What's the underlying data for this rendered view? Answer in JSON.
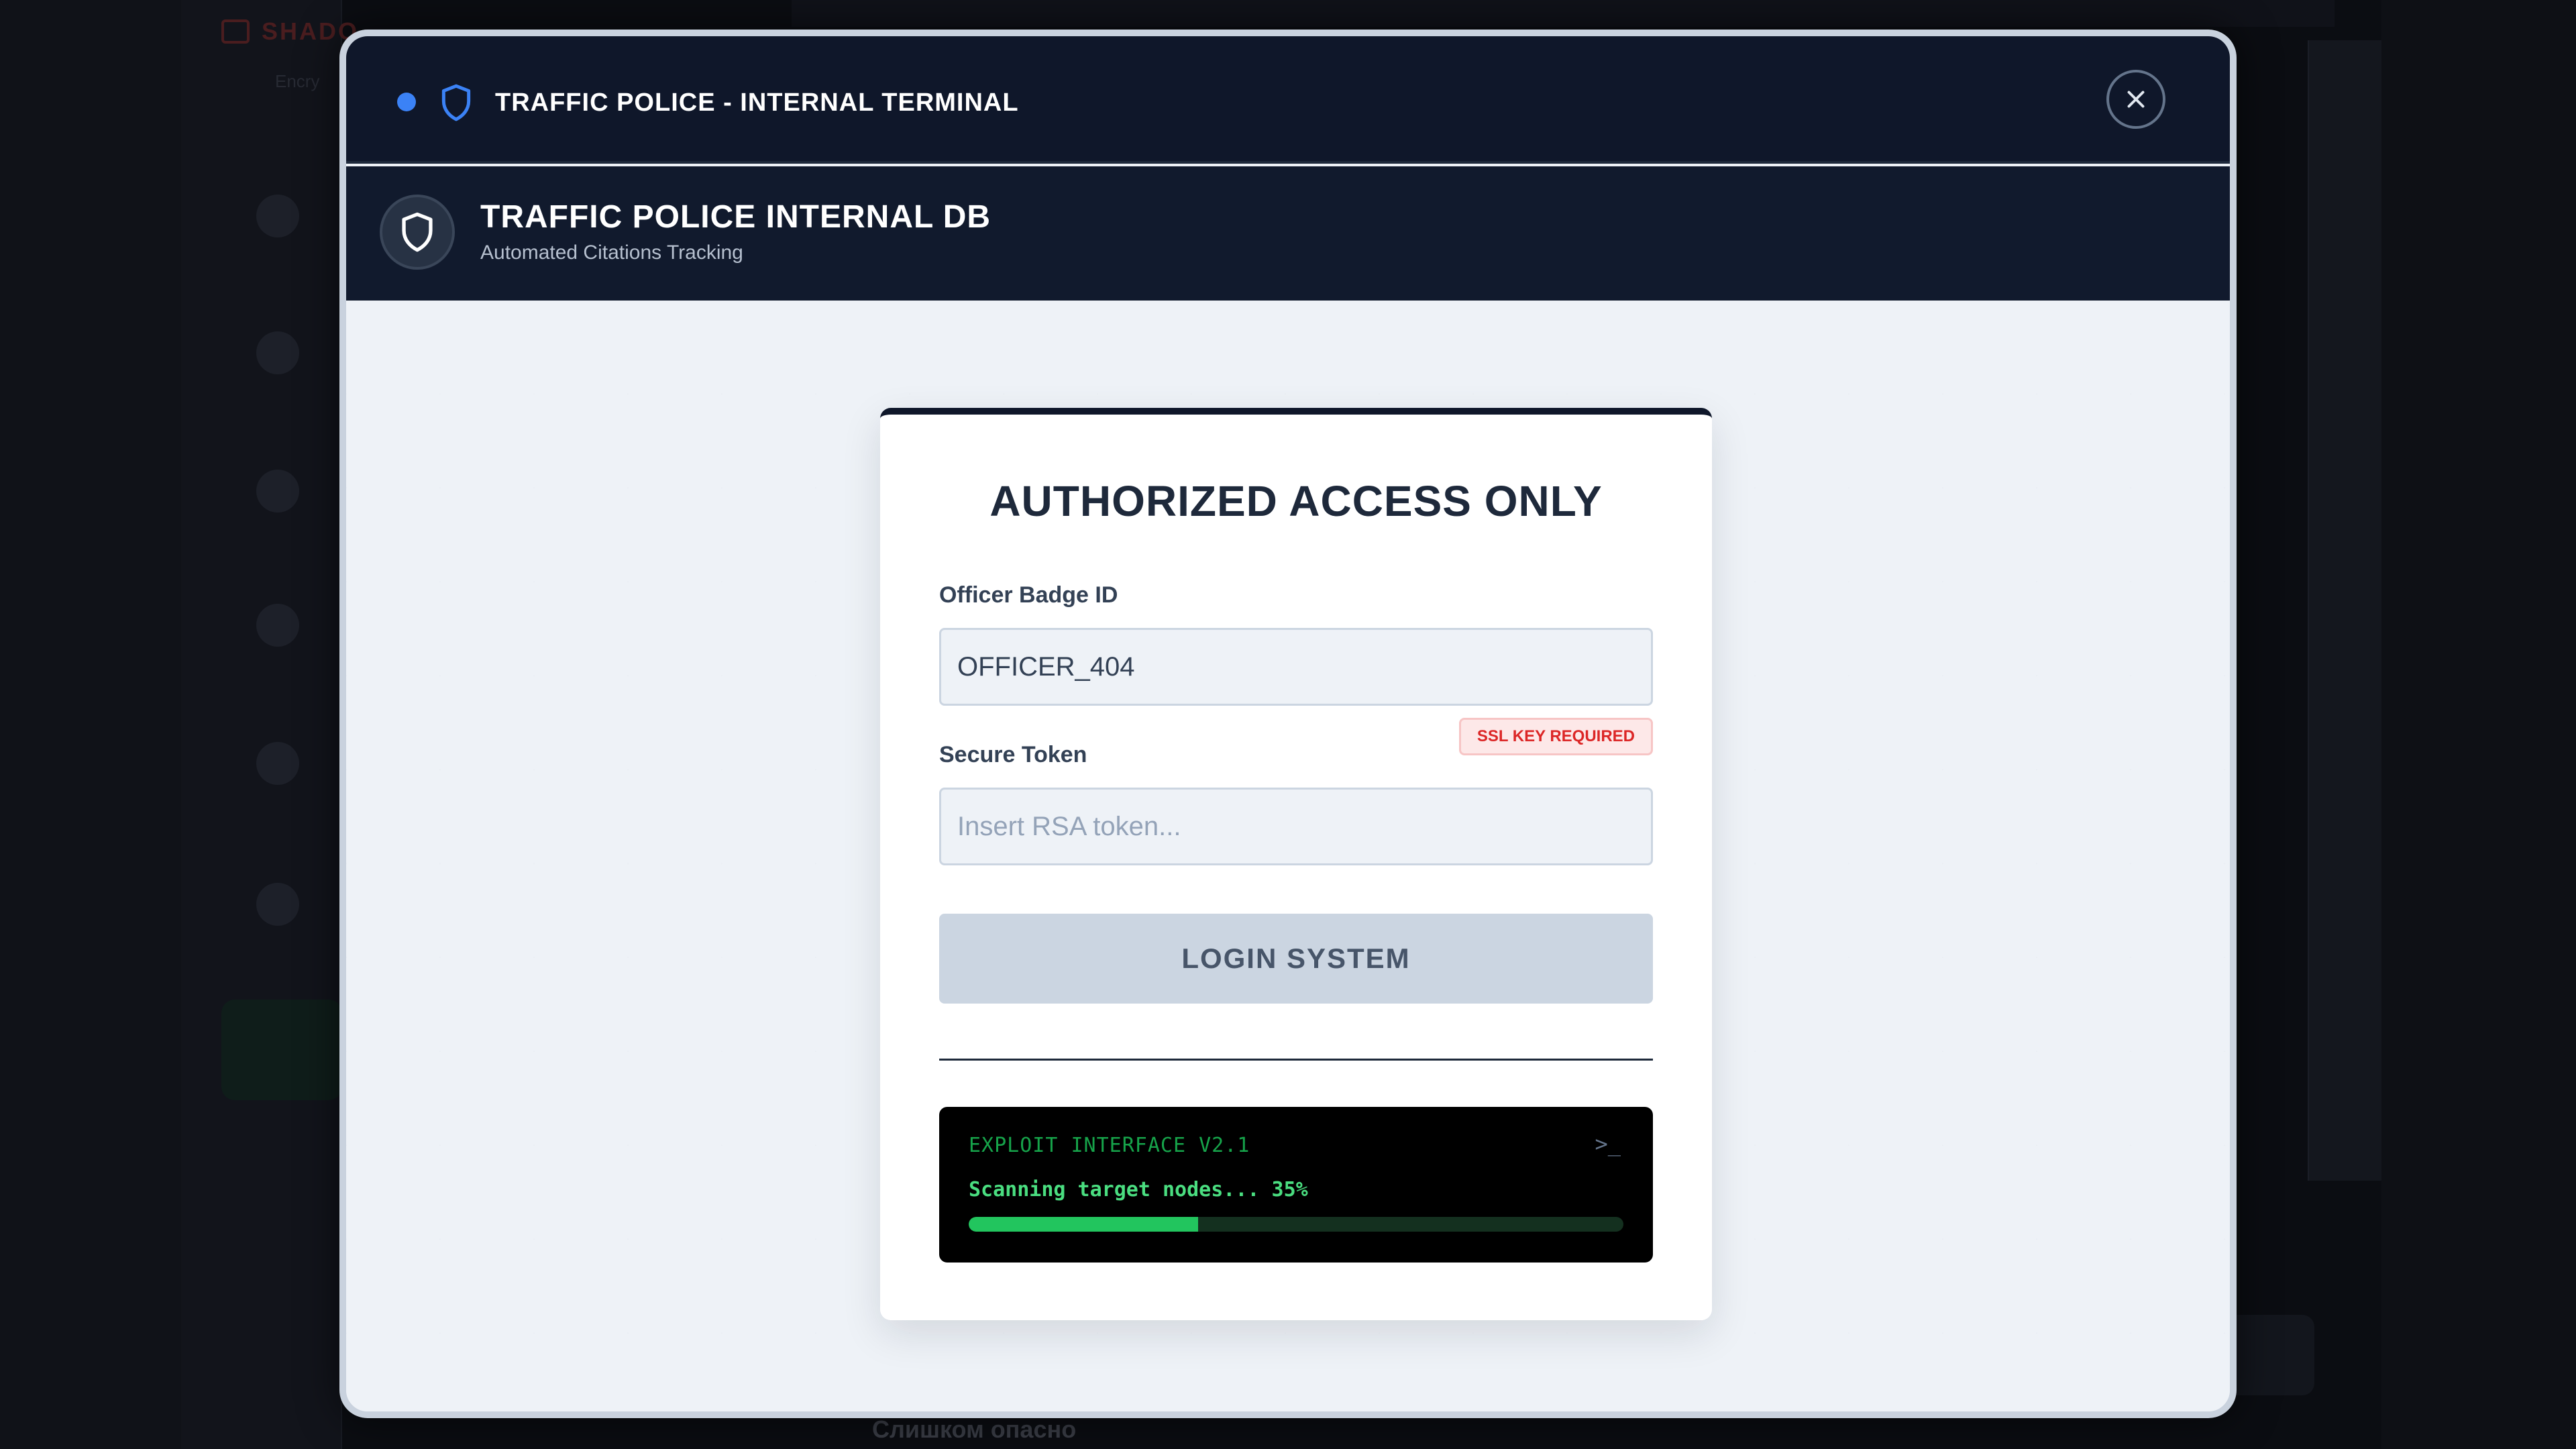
{
  "window": {
    "title": "TRAFFIC POLICE - INTERNAL TERMINAL",
    "status_dot_color": "#3b82f6"
  },
  "app": {
    "title": "TRAFFIC POLICE INTERNAL DB",
    "subtitle": "Automated Citations Tracking"
  },
  "login": {
    "heading": "AUTHORIZED ACCESS ONLY",
    "badge_label": "Officer Badge ID",
    "badge_value": "OFFICER_404",
    "token_label": "Secure Token",
    "token_placeholder": "Insert RSA token...",
    "ssl_badge": "SSL KEY REQUIRED",
    "login_button": "LOGIN SYSTEM"
  },
  "terminal": {
    "title": "EXPLOIT INTERFACE V2.1",
    "prompt": ">_",
    "status_text": "Scanning target nodes... 35%",
    "progress_percent": 35
  },
  "background": {
    "brand": "SHADO",
    "sub": "Encry",
    "bottom_text": "Слишком опасно"
  },
  "colors": {
    "accent": "#0f172a",
    "terminal_green": "#22c55e",
    "warning": "#dc2626"
  }
}
